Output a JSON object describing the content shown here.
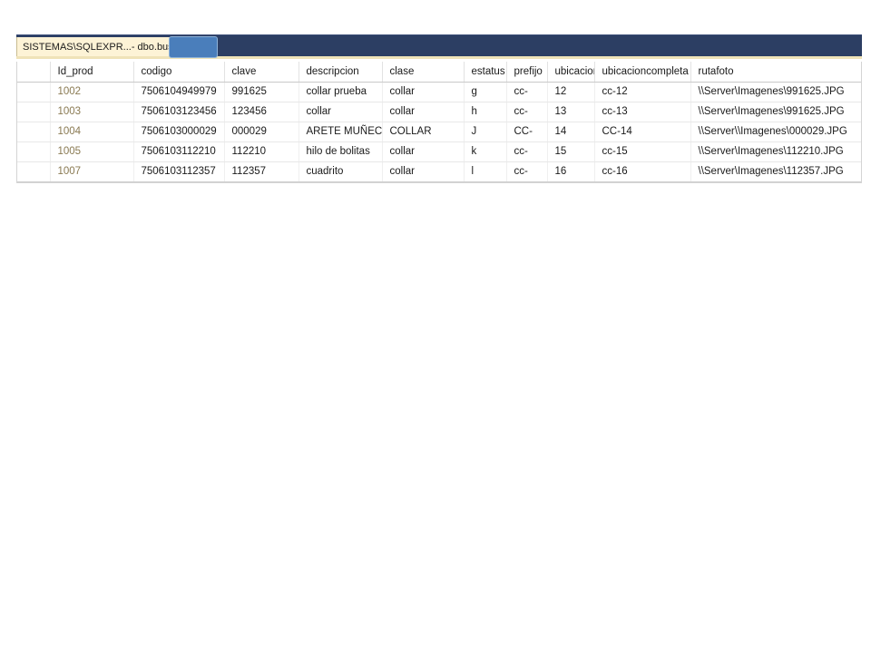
{
  "window": {
    "tab_label": "SISTEMAS\\SQLEXPR...- dbo.busca",
    "overlay_name": "selection-highlight",
    "titlebar_color": "#2c3e63",
    "tab_background": "#fdf3d6",
    "accent_color": "#4a7ebb"
  },
  "grid": {
    "columns": [
      {
        "key": "id_prod",
        "label": "Id_prod"
      },
      {
        "key": "codigo",
        "label": "codigo"
      },
      {
        "key": "clave",
        "label": "clave"
      },
      {
        "key": "descripcion",
        "label": "descripcion"
      },
      {
        "key": "clase",
        "label": "clase"
      },
      {
        "key": "estatus",
        "label": "estatus"
      },
      {
        "key": "prefijo",
        "label": "prefijo"
      },
      {
        "key": "ubicacion",
        "label": "ubicacion"
      },
      {
        "key": "ubicacioncompleta",
        "label": "ubicacioncompleta"
      },
      {
        "key": "rutafoto",
        "label": "rutafoto"
      }
    ],
    "rows": [
      {
        "id_prod": "1002",
        "codigo": "7506104949979",
        "clave": "991625",
        "descripcion": "collar prueba",
        "clase": "collar",
        "estatus": "g",
        "prefijo": "cc-",
        "ubicacion": "12",
        "ubicacioncompleta": "cc-12",
        "rutafoto": "\\\\Server\\Imagenes\\991625.JPG"
      },
      {
        "id_prod": "1003",
        "codigo": "7506103123456",
        "clave": "123456",
        "descripcion": "collar",
        "clase": "collar",
        "estatus": "h",
        "prefijo": "cc-",
        "ubicacion": "13",
        "ubicacioncompleta": "cc-13",
        "rutafoto": "\\\\Server\\Imagenes\\991625.JPG"
      },
      {
        "id_prod": "1004",
        "codigo": "7506103000029",
        "clave": "000029",
        "descripcion": "ARETE MUÑEC...",
        "clase": "COLLAR",
        "estatus": "J",
        "prefijo": "CC-",
        "ubicacion": "14",
        "ubicacioncompleta": "CC-14",
        "rutafoto": "\\\\Server\\\\Imagenes\\000029.JPG"
      },
      {
        "id_prod": "1005",
        "codigo": "7506103112210",
        "clave": "112210",
        "descripcion": "hilo de bolitas",
        "clase": "collar",
        "estatus": "k",
        "prefijo": "cc-",
        "ubicacion": "15",
        "ubicacioncompleta": "cc-15",
        "rutafoto": "\\\\Server\\Imagenes\\112210.JPG"
      },
      {
        "id_prod": "1007",
        "codigo": "7506103112357",
        "clave": "112357",
        "descripcion": "cuadrito",
        "clase": "collar",
        "estatus": "l",
        "prefijo": "cc-",
        "ubicacion": "16",
        "ubicacioncompleta": "cc-16",
        "rutafoto": "\\\\Server\\Imagenes\\112357.JPG"
      }
    ]
  }
}
